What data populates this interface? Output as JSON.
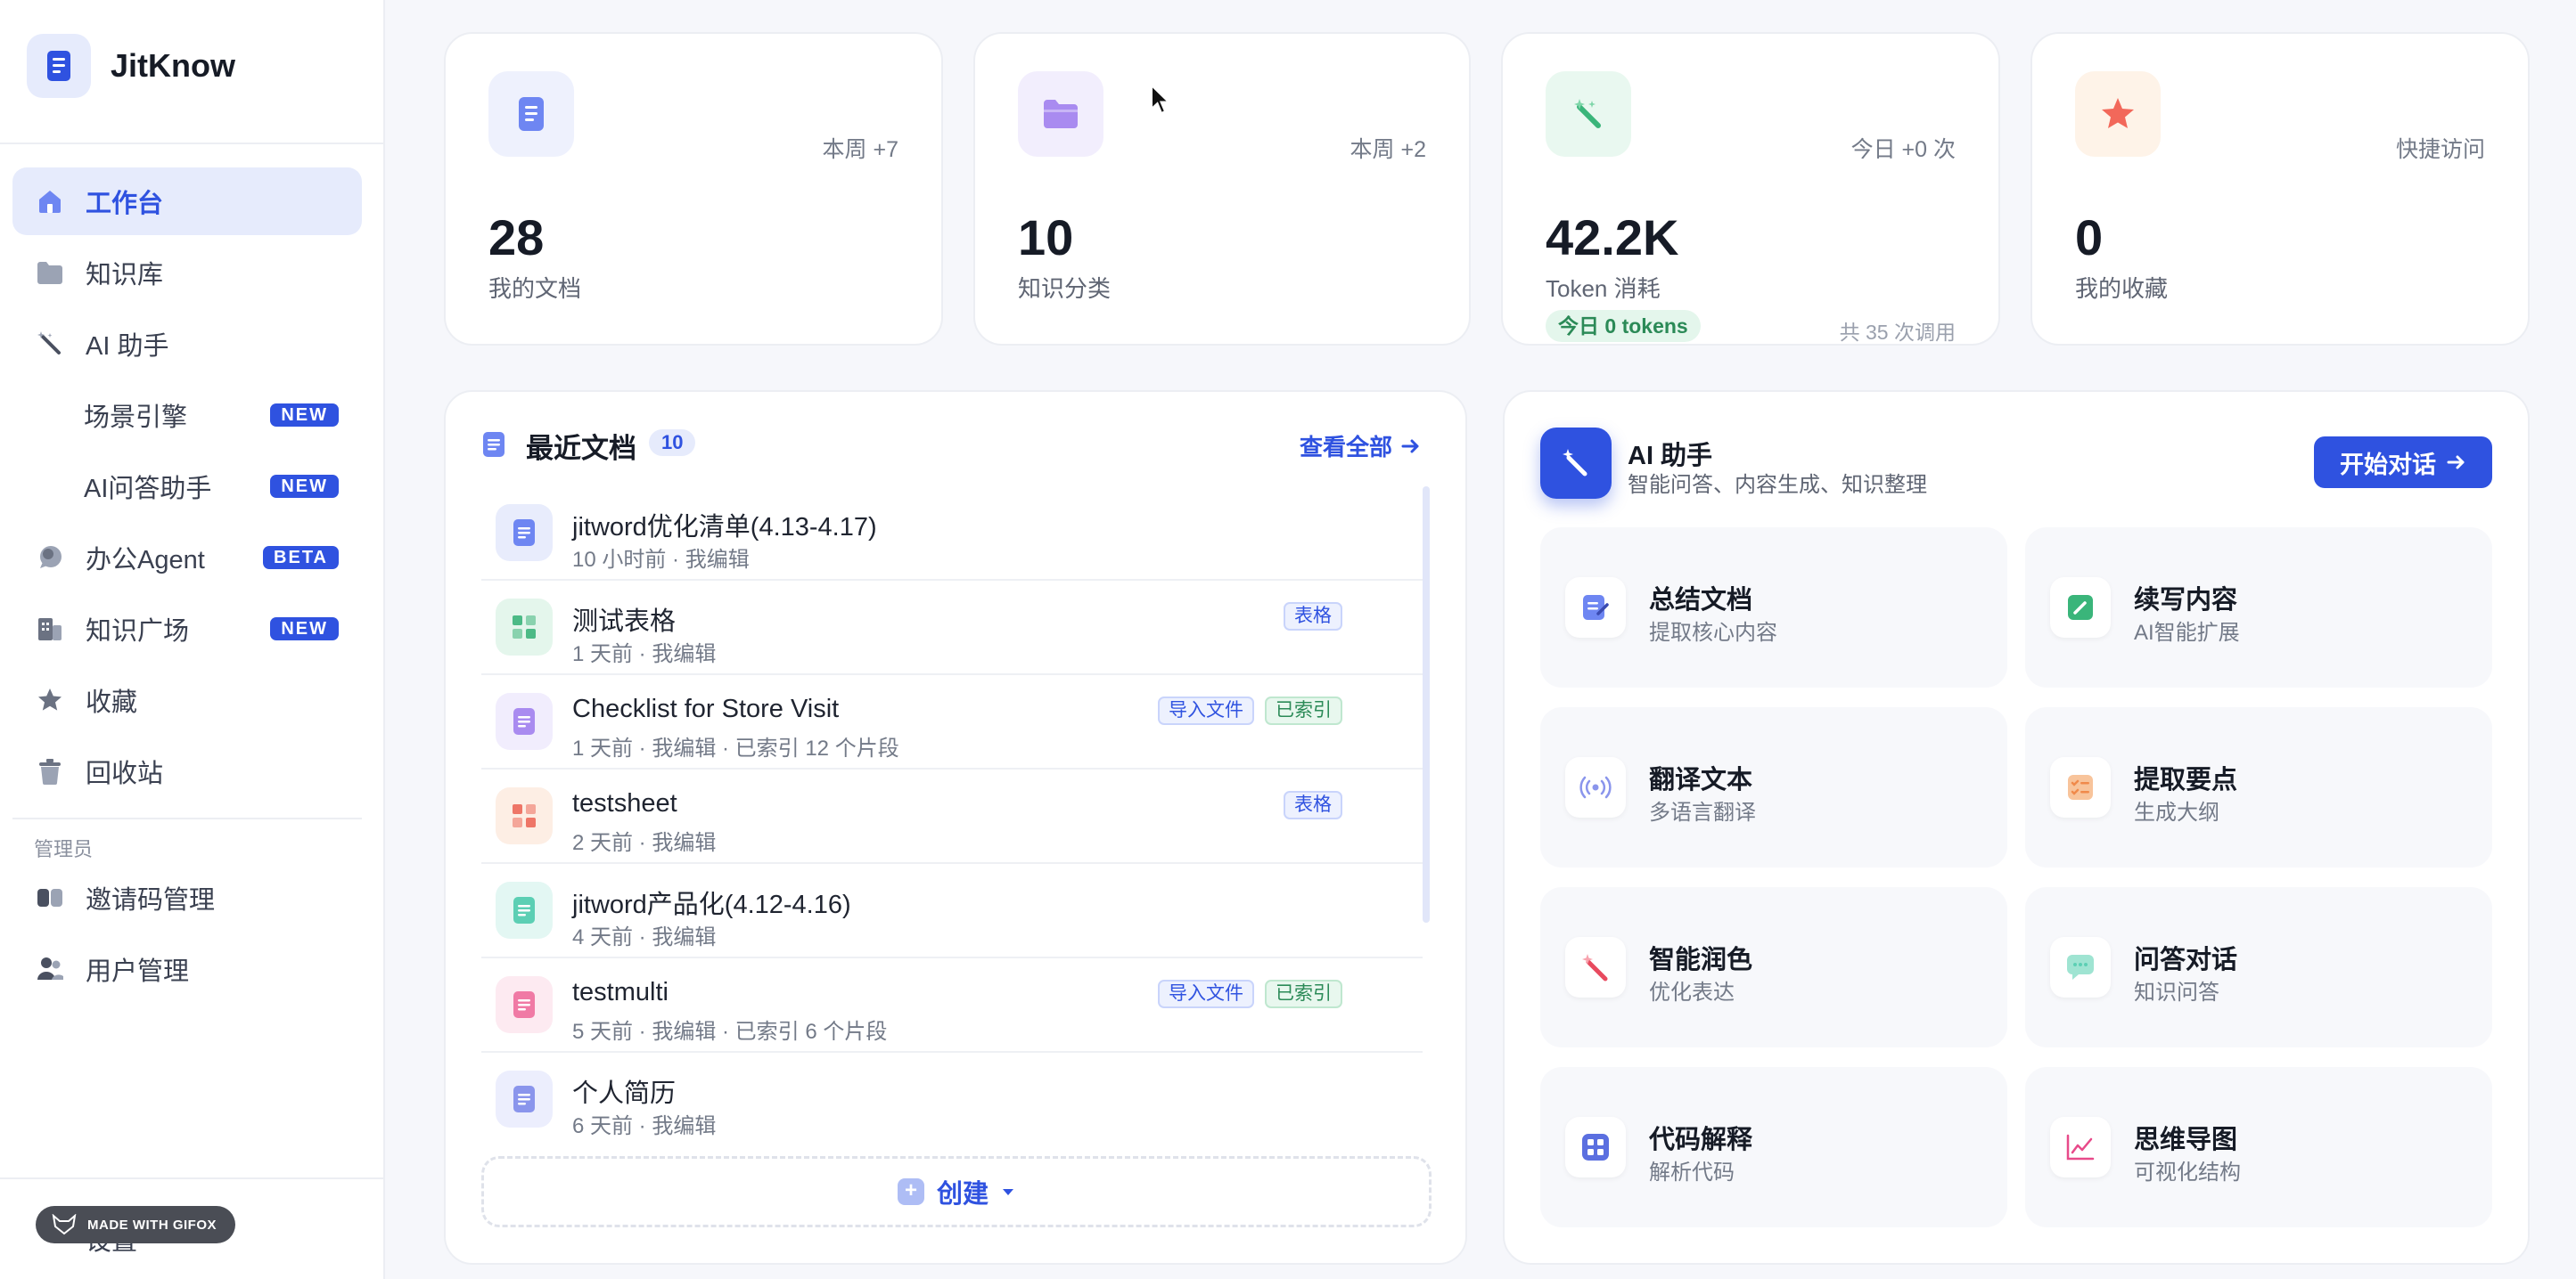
{
  "app": {
    "name": "JitKnow"
  },
  "sidebar": {
    "items": [
      {
        "label": "工作台",
        "icon": "home-icon",
        "active": true
      },
      {
        "label": "知识库",
        "icon": "folder-icon"
      },
      {
        "label": "AI 助手",
        "icon": "magic-wand-icon"
      },
      {
        "label": "场景引擎",
        "badge": "NEW"
      },
      {
        "label": "AI问答助手",
        "badge": "NEW"
      },
      {
        "label": "办公Agent",
        "icon": "chat-bubble-icon",
        "badge": "BETA"
      },
      {
        "label": "知识广场",
        "icon": "building-icon",
        "badge": "NEW"
      },
      {
        "label": "收藏",
        "icon": "star-icon"
      },
      {
        "label": "回收站",
        "icon": "trash-icon"
      }
    ],
    "admin_group": "管理员",
    "admin_items": [
      {
        "label": "邀请码管理",
        "icon": "ticket-icon"
      },
      {
        "label": "用户管理",
        "icon": "users-icon"
      }
    ],
    "settings_label": "设置",
    "watermark": "MADE WITH GIFOX"
  },
  "stats": [
    {
      "icon": "document-icon",
      "hint": "本周 +7",
      "value": "28",
      "label": "我的文档",
      "color": "#6e86f2",
      "bg": "#eef1fd"
    },
    {
      "icon": "folder-icon",
      "hint": "本周 +2",
      "value": "10",
      "label": "知识分类",
      "color": "#a98bf0",
      "bg": "#f2eefd"
    },
    {
      "icon": "magic-wand-icon",
      "hint": "今日 +0 次",
      "value": "42.2K",
      "label": "Token 消耗",
      "chip": "今日 0 tokens",
      "sub": "共 35 次调用",
      "color": "#3ab57a",
      "bg": "#e9f8f0"
    },
    {
      "icon": "star-icon",
      "hint": "快捷访问",
      "value": "0",
      "label": "我的收藏",
      "color": "#f2685a",
      "bg": "#fef3e8"
    }
  ],
  "recent": {
    "title": "最近文档",
    "count": "10",
    "view_all": "查看全部",
    "create_label": "创建",
    "docs": [
      {
        "name": "jitword优化清单(4.13-4.17)",
        "meta": "10 小时前 · 我编辑",
        "tags": [],
        "icon": "document-icon",
        "color": "#6e86f2",
        "bg": "#e8ecfc"
      },
      {
        "name": "测试表格",
        "meta": "1 天前 · 我编辑",
        "tags": [
          {
            "text": "表格",
            "kind": "blue"
          }
        ],
        "icon": "sheet-icon",
        "color": "#4cba86",
        "bg": "#e4f6ec"
      },
      {
        "name": "Checklist for Store Visit",
        "meta": "1 天前 · 我编辑 · 已索引 12 个片段",
        "tags": [
          {
            "text": "导入文件",
            "kind": "blue"
          },
          {
            "text": "已索引",
            "kind": "green"
          }
        ],
        "icon": "document-icon",
        "color": "#a98bf0",
        "bg": "#f1edfd"
      },
      {
        "name": "testsheet",
        "meta": "2 天前 · 我编辑",
        "tags": [
          {
            "text": "表格",
            "kind": "blue"
          }
        ],
        "icon": "sheet-icon",
        "color": "#ee7667",
        "bg": "#fdeee4"
      },
      {
        "name": "jitword产品化(4.12-4.16)",
        "meta": "4 天前 · 我编辑",
        "tags": [],
        "icon": "document-icon",
        "color": "#5ccfb4",
        "bg": "#e3f7f3"
      },
      {
        "name": "testmulti",
        "meta": "5 天前 · 我编辑 · 已索引 6 个片段",
        "tags": [
          {
            "text": "导入文件",
            "kind": "blue"
          },
          {
            "text": "已索引",
            "kind": "green"
          }
        ],
        "icon": "document-icon",
        "color": "#f07aa5",
        "bg": "#fdeaf1"
      },
      {
        "name": "个人简历",
        "meta": "6 天前 · 我编辑",
        "tags": [],
        "icon": "document-icon",
        "color": "#8a95ec",
        "bg": "#eceefd"
      }
    ]
  },
  "ai": {
    "title": "AI 助手",
    "subtitle": "智能问答、内容生成、知识整理",
    "start_label": "开始对话",
    "tools": [
      {
        "title": "总结文档",
        "desc": "提取核心内容",
        "icon": "summary-icon",
        "color": "#6e86f2"
      },
      {
        "title": "续写内容",
        "desc": "AI智能扩展",
        "icon": "pencil-icon",
        "color": "#3ab57a"
      },
      {
        "title": "翻译文本",
        "desc": "多语言翻译",
        "icon": "broadcast-icon",
        "color": "#8a95ec"
      },
      {
        "title": "提取要点",
        "desc": "生成大纲",
        "icon": "checklist-icon",
        "color": "#f08a4b"
      },
      {
        "title": "智能润色",
        "desc": "优化表达",
        "icon": "magic-wand-icon",
        "color": "#e84a5f"
      },
      {
        "title": "问答对话",
        "desc": "知识问答",
        "icon": "chat-icon",
        "color": "#5ccfb4"
      },
      {
        "title": "代码解释",
        "desc": "解析代码",
        "icon": "grid-icon",
        "color": "#5b6fe0"
      },
      {
        "title": "思维导图",
        "desc": "可视化结构",
        "icon": "line-chart-icon",
        "color": "#e84a8a"
      }
    ]
  }
}
